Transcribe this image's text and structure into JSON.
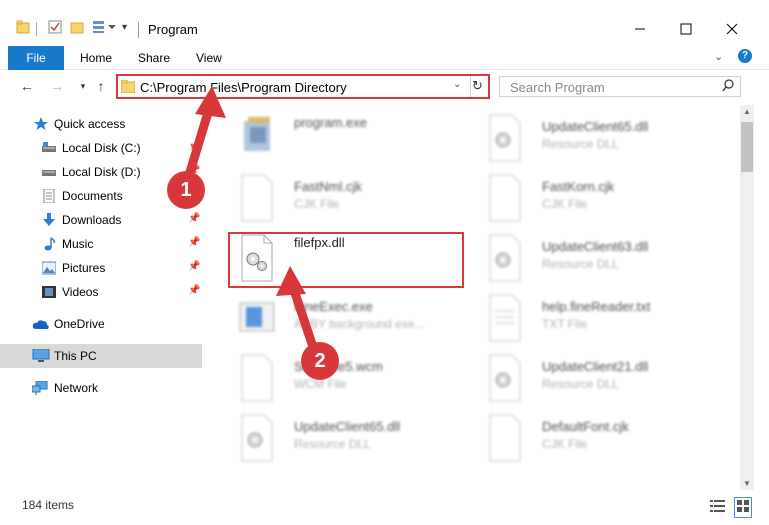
{
  "window": {
    "title": "Program"
  },
  "ribbon": {
    "file_tab": "File",
    "tabs": [
      "Home",
      "Share",
      "View"
    ]
  },
  "address": {
    "path": "C:\\Program Files\\Program Directory"
  },
  "search": {
    "placeholder": "Search Program"
  },
  "sidebar": {
    "items": [
      {
        "label": "Quick access",
        "icon": "star-icon"
      },
      {
        "label": "Local Disk (C:)",
        "icon": "drive-icon"
      },
      {
        "label": "Local Disk (D:)",
        "icon": "drive-icon"
      },
      {
        "label": "Documents",
        "icon": "documents-icon"
      },
      {
        "label": "Downloads",
        "icon": "downloads-icon"
      },
      {
        "label": "Music",
        "icon": "music-icon"
      },
      {
        "label": "Pictures",
        "icon": "pictures-icon"
      },
      {
        "label": "Videos",
        "icon": "videos-icon"
      },
      {
        "label": "OneDrive",
        "icon": "cloud-icon"
      },
      {
        "label": "This PC",
        "icon": "computer-icon"
      },
      {
        "label": "Network",
        "icon": "network-icon"
      }
    ]
  },
  "files": [
    {
      "name": "program.exe",
      "type": ""
    },
    {
      "name": "UpdateClient65.dll",
      "type": "Resource DLL"
    },
    {
      "name": "FastNml.cjk",
      "type": "CJK File"
    },
    {
      "name": "FastKorn.cjk",
      "type": "CJK File"
    },
    {
      "name": "filefpx.dll",
      "type": ""
    },
    {
      "name": "UpdateClient63.dll",
      "type": "Resource DLL"
    },
    {
      "name": "FineExec.exe",
      "type": "ABBY background exe..."
    },
    {
      "name": "help.fineReader.txt",
      "type": "TXT File"
    },
    {
      "name": "SnapFile5.wcm",
      "type": "WCM File"
    },
    {
      "name": "UpdateClient21.dll",
      "type": "Resource DLL"
    },
    {
      "name": "UpdateClient65.dll",
      "type": "Resource DLL"
    },
    {
      "name": "DefaultFont.cjk",
      "type": "CJK File"
    }
  ],
  "status": {
    "item_count": "184 items"
  },
  "callouts": [
    "1",
    "2"
  ],
  "colors": {
    "accent": "#1979ca",
    "highlight": "#d9383a"
  }
}
